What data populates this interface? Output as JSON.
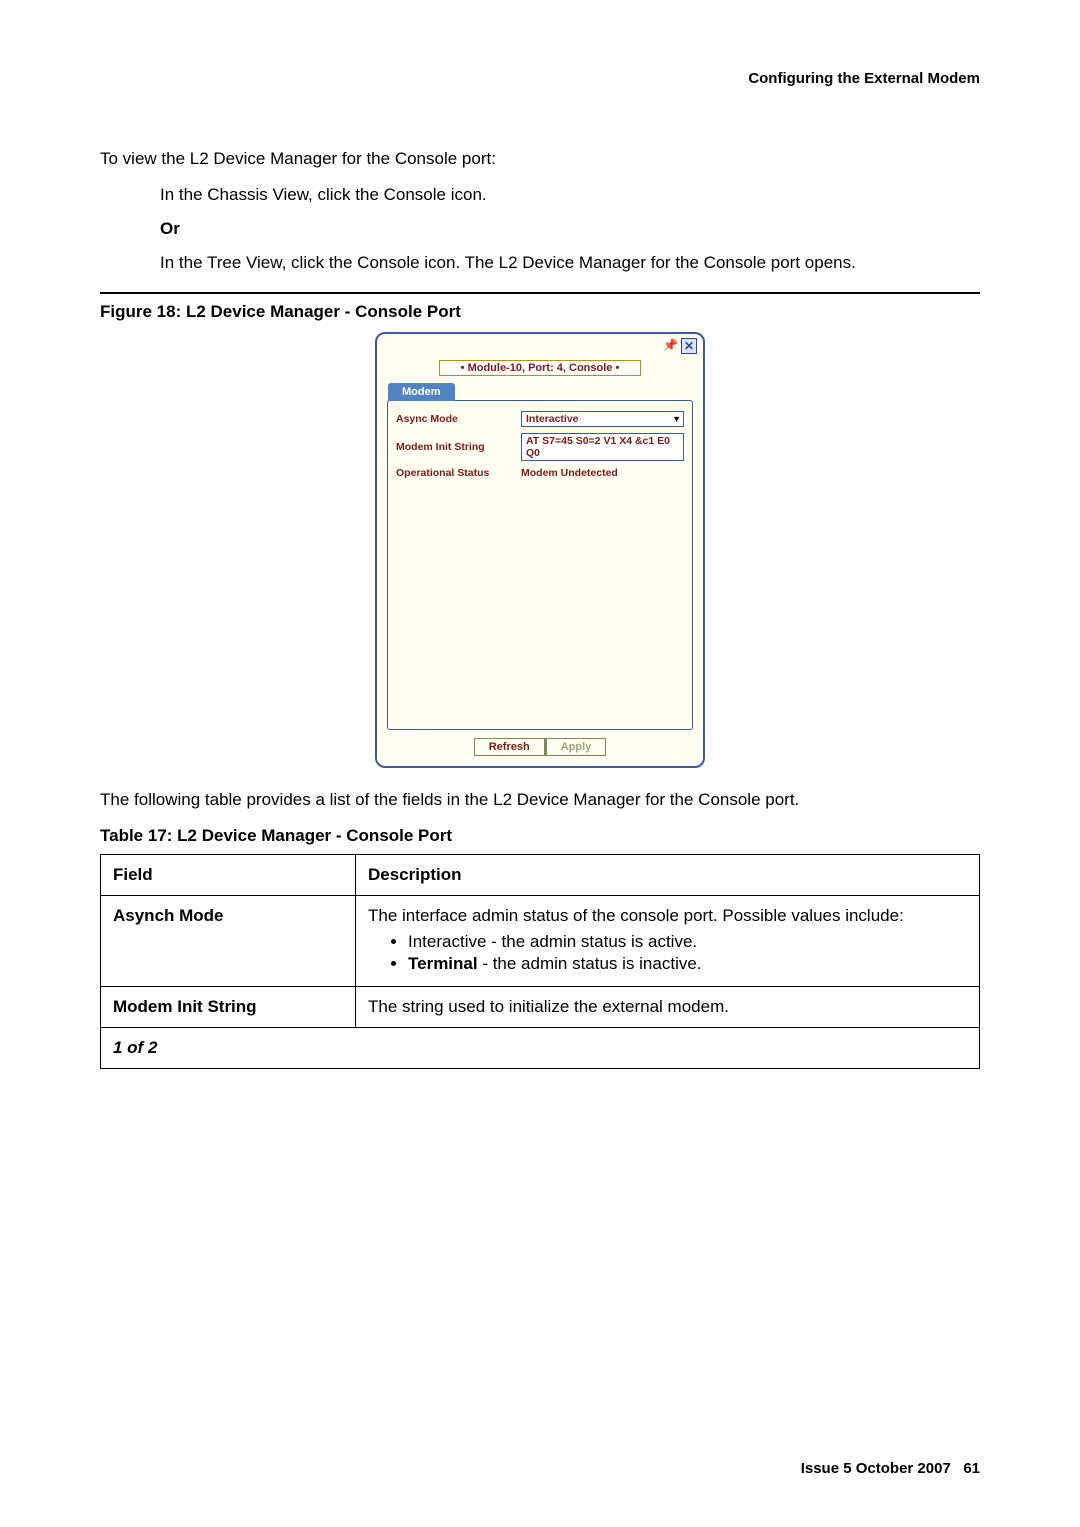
{
  "header": {
    "title": "Configuring the External Modem"
  },
  "intro": "To view the L2 Device Manager for the Console port:",
  "step1": "In the Chassis View, click the Console icon.",
  "or": "Or",
  "step2": "In the Tree View, click the Console icon. The L2 Device Manager for the Console port opens.",
  "figure_title": "Figure 18: L2 Device Manager - Console Port",
  "dialog": {
    "close_glyph": "✕",
    "pin_glyph": "📌",
    "title": "• Module-10, Port: 4, Console •",
    "tab": "Modem",
    "rows": {
      "async_label": "Async Mode",
      "async_value": "Interactive",
      "init_label": "Modem Init String",
      "init_value": "AT S7=45 S0=2 V1 X4 &c1 E0 Q0",
      "status_label": "Operational Status",
      "status_value": "Modem Undetected"
    },
    "buttons": {
      "refresh": "Refresh",
      "apply": "Apply"
    }
  },
  "after_figure": "The following table provides a list of the fields in the L2 Device Manager for the Console port.",
  "table_title": "Table 17: L2 Device Manager - Console Port",
  "table": {
    "head_field": "Field",
    "head_desc": "Description",
    "rows": [
      {
        "field": "Asynch Mode",
        "desc_intro": "The interface admin status of the console port. Possible values include:",
        "bullet1_plain": "Interactive - the admin status is active.",
        "bullet2_bold": "Terminal",
        "bullet2_rest": " - the admin status is inactive."
      },
      {
        "field": "Modem Init String",
        "desc": "The string used to initialize the external modem."
      }
    ],
    "pager": "1 of 2"
  },
  "footer": {
    "issue": "Issue 5   October 2007",
    "page": "61"
  }
}
